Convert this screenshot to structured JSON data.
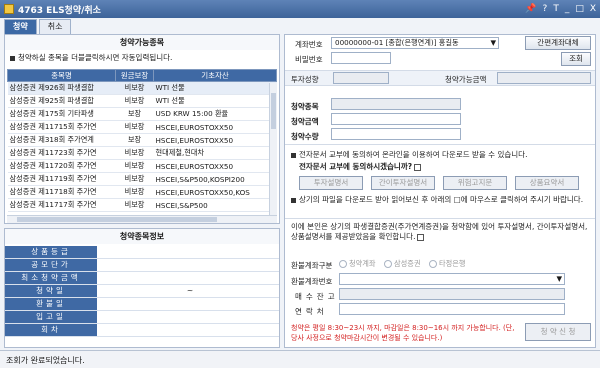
{
  "window": {
    "title": "4763 ELS청약/취소",
    "controls": [
      "pin",
      "?",
      "T",
      "_",
      "□",
      "X"
    ]
  },
  "tabs": [
    {
      "label": "청약",
      "active": true
    },
    {
      "label": "취소",
      "active": false
    }
  ],
  "available": {
    "title": "청약가능종목",
    "note": "청약하실 종목을 더블클릭하시면 자동입력됩니다.",
    "columns": [
      "종목명",
      "원금보장",
      "기초자산"
    ],
    "rows": [
      [
        "삼성증권 제926회 파생결합",
        "비보장",
        "WTI 선물"
      ],
      [
        "삼성증권 제925회 파생결합",
        "비보장",
        "WTI 선물"
      ],
      [
        "삼성증권 제175회 기타파생",
        "보장",
        "USD KRW 15:00 환율"
      ],
      [
        "삼성증권 제11715회 주가연",
        "비보장",
        "HSCEI,EUROSTOXX50"
      ],
      [
        "삼성증권 제318회 주가연계",
        "보장",
        "HSCEI,EUROSTOXX50"
      ],
      [
        "삼성증권 제11723회 주가연",
        "비보장",
        "현대제철,현대차"
      ],
      [
        "삼성증권 제11720회 주가연",
        "비보장",
        "HSCEI,EUROSTOXX50"
      ],
      [
        "삼성증권 제11719회 주가연",
        "비보장",
        "HSCEI,S&P500,KOSPI200"
      ],
      [
        "삼성증권 제11718회 주가연",
        "비보장",
        "HSCEI,EUROSTOXX50,KOS"
      ],
      [
        "삼성증권 제11717회 주가연",
        "비보장",
        "HSCEI,S&P500"
      ]
    ]
  },
  "info": {
    "title": "청약종목정보",
    "rows": [
      {
        "label": "상품등급",
        "value": ""
      },
      {
        "label": "공모단가",
        "value": ""
      },
      {
        "label": "최소청약금액",
        "value": ""
      },
      {
        "label": "청약일",
        "value": "~"
      },
      {
        "label": "환불일",
        "value": ""
      },
      {
        "label": "입고일",
        "value": ""
      },
      {
        "label": "회차",
        "value": ""
      }
    ]
  },
  "account": {
    "label_account": "계좌번호",
    "account_value": "00000000-01 [종합(은행연계)] 홍길동",
    "simple_btn": "간편계좌대체",
    "label_password": "비밀번호",
    "inquiry_btn": "조회",
    "label_tendency": "투자성향",
    "label_available": "청약가능금액"
  },
  "order": {
    "label_item": "청약종목",
    "label_amount": "청약금액",
    "label_qty": "청약수량"
  },
  "docs": {
    "consent": "전자문서 교부에 동의하여 온라인을 이용하여 다운로드 받을 수 있습니다.",
    "consent_q": "전자문서 교부에 동의하시겠습니까?",
    "buttons": [
      "투자설명서",
      "간이투자설명서",
      "위험고지문",
      "상품요약서"
    ],
    "download_note": "상기의 파일을 다운로드 받아 읽어보신 후 아래의 □에 마우스로 클릭하여 주시기 바랍니다.",
    "confirm": "이에 본인은 상기의 파생결합증권(주가연계증권)을 청약함에 있어 투자설명서, 간이투자설명서, 상품설명서를 제공받았음을 확인합니다."
  },
  "refund": {
    "label_type": "환불계좌구분",
    "options": [
      "청약계좌",
      "삼성증권",
      "타정은행"
    ],
    "label_account": "환불계좌번호",
    "label_balance": "매수잔고",
    "label_contact": "연락처",
    "notice": "청약은 평일 8:30~23시 까지, 마감일은 8:30~16시 까지 가능합니다. (단, 당사 사정으로 청약마감시간이 변경될 수 있습니다.)",
    "submit": "청 약 신 청"
  },
  "status": "조회가 완료되었습니다."
}
